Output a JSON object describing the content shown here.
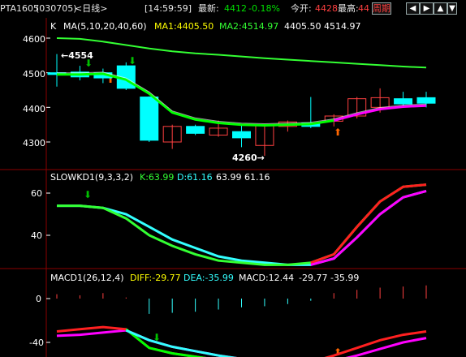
{
  "header": {
    "symbol": "PTA1605",
    "code": "(030705)",
    "period": "<日线>",
    "time": "[14:59:59]",
    "last_label": "最新:",
    "last_value": "4412",
    "change": "-0.18%",
    "open_label": "今开:",
    "open_value": "4428",
    "high_label": "最高:",
    "high_value": "44",
    "period_button": "周期",
    "nav_buttons": [
      "◀",
      "▶",
      "▲",
      "▼",
      "✦"
    ]
  },
  "colors": {
    "rise": "#ff4040",
    "fall": "#00ffff",
    "ma5": "#ffffff",
    "ma10": "#ffff00",
    "ma20": "#33ff33",
    "ma40": "#33ff33",
    "grid": "#8b0000",
    "k": "#33ff33",
    "d": "#33ffff",
    "macd_bar_pos": "#ff4040",
    "macd_bar_neg": "#33ffff",
    "bright_green": "#00ff00",
    "magenta": "#ff00ff"
  },
  "main_panel": {
    "label_k": "K",
    "ma_text": "MA(5,10,20,40,60)",
    "ma1_text": "MA1:4405.50",
    "ma2_text": "MA2:4514.97",
    "extra_text": "4405.50 4514.97",
    "high_marker": "4554",
    "low_marker": "4260",
    "y_ticks": [
      "4600",
      "4500",
      "4400",
      "4300"
    ]
  },
  "kdj_panel": {
    "title": "SLOWKD1(9,3,3,2)",
    "k_text": "K:63.99",
    "d_text": "D:61.16",
    "extra_text": "63.99 61.16",
    "y_ticks": [
      "60",
      "40"
    ]
  },
  "macd_panel": {
    "title": "MACD1(26,12,4)",
    "diff_text": "DIFF:-29.77",
    "dea_text": "DEA:-35.99",
    "macd_text": "MACD:12.44",
    "extra_text": "-29.77 -35.99",
    "y_ticks": [
      "0",
      "-40"
    ]
  },
  "chart_data": {
    "type": "candlestick",
    "candles": [
      {
        "o": 4500,
        "h": 4554,
        "l": 4460,
        "c": 4495
      },
      {
        "o": 4502,
        "h": 4520,
        "l": 4478,
        "c": 4488
      },
      {
        "o": 4500,
        "h": 4512,
        "l": 4470,
        "c": 4485
      },
      {
        "o": 4520,
        "h": 4530,
        "l": 4450,
        "c": 4455
      },
      {
        "o": 4430,
        "h": 4432,
        "l": 4300,
        "c": 4305
      },
      {
        "o": 4300,
        "h": 4350,
        "l": 4280,
        "c": 4345
      },
      {
        "o": 4345,
        "h": 4350,
        "l": 4320,
        "c": 4325
      },
      {
        "o": 4320,
        "h": 4362,
        "l": 4315,
        "c": 4340
      },
      {
        "o": 4330,
        "h": 4352,
        "l": 4285,
        "c": 4312
      },
      {
        "o": 4290,
        "h": 4350,
        "l": 4260,
        "c": 4350
      },
      {
        "o": 4345,
        "h": 4362,
        "l": 4330,
        "c": 4358
      },
      {
        "o": 4355,
        "h": 4430,
        "l": 4340,
        "c": 4345
      },
      {
        "o": 4360,
        "h": 4380,
        "l": 4345,
        "c": 4375
      },
      {
        "o": 4375,
        "h": 4430,
        "l": 4368,
        "c": 4425
      },
      {
        "o": 4400,
        "h": 4455,
        "l": 4385,
        "c": 4428
      },
      {
        "o": 4425,
        "h": 4445,
        "l": 4405,
        "c": 4410
      },
      {
        "o": 4428,
        "h": 4445,
        "l": 4400,
        "c": 4412
      }
    ],
    "ma_short": [
      4495,
      4495,
      4497,
      4480,
      4440,
      4385,
      4365,
      4355,
      4350,
      4348,
      4350,
      4352,
      4362,
      4380,
      4395,
      4402,
      4405
    ],
    "ma_long": [
      4600,
      4598,
      4590,
      4580,
      4570,
      4562,
      4556,
      4552,
      4547,
      4542,
      4538,
      4534,
      4530,
      4526,
      4522,
      4518,
      4515
    ],
    "k": [
      54,
      54,
      53,
      48,
      40,
      35,
      31,
      28,
      27,
      26,
      26,
      27,
      31,
      44,
      56,
      63,
      64
    ],
    "d": [
      54,
      54,
      53,
      50,
      44,
      38,
      34,
      30,
      28,
      27,
      26,
      26,
      29,
      39,
      50,
      58,
      61
    ],
    "diff": [
      -30,
      -28,
      -26,
      -28,
      -45,
      -50,
      -53,
      -56,
      -58,
      -60,
      -61,
      -58,
      -52,
      -45,
      -38,
      -33,
      -30
    ],
    "dea": [
      -34,
      -33,
      -31,
      -29,
      -38,
      -44,
      -48,
      -52,
      -55,
      -58,
      -60,
      -60,
      -57,
      -52,
      -46,
      -40,
      -36
    ],
    "macd": [
      4,
      3,
      5,
      1,
      -14,
      -13,
      -12,
      -10,
      -8,
      -7,
      -5,
      -2,
      5,
      8,
      10,
      11,
      12
    ],
    "price_ylim": [
      4260,
      4620
    ],
    "kd_ylim": [
      20,
      75
    ],
    "macd_ylim": [
      -45,
      5
    ]
  }
}
